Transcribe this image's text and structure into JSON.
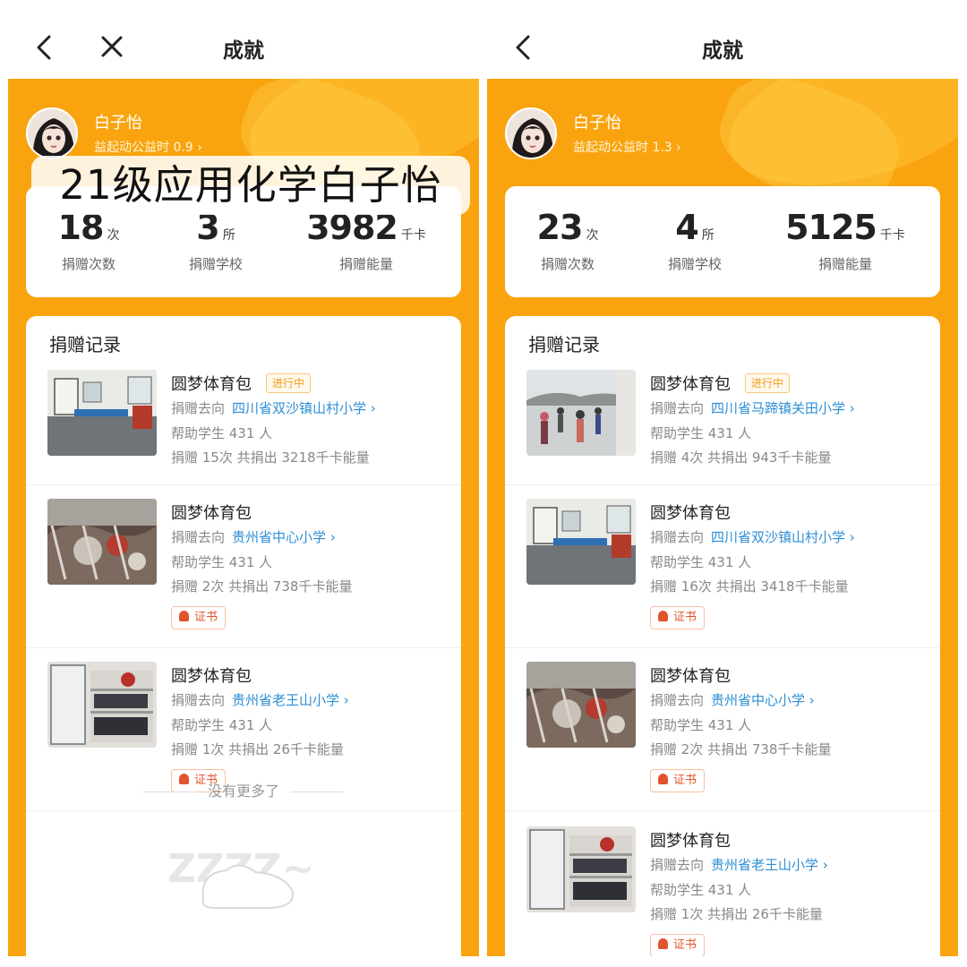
{
  "left": {
    "title": "成就",
    "user": {
      "name": "白子怡",
      "subtitle": "益起动公益时 0.9 ›"
    },
    "overlay": "21级应用化学白子怡",
    "stats": [
      {
        "value": "18",
        "unit": "次",
        "label": "捐赠次数"
      },
      {
        "value": "3",
        "unit": "所",
        "label": "捐赠学校"
      },
      {
        "value": "3982",
        "unit": "千卡",
        "label": "捐赠能量"
      }
    ],
    "records_title": "捐赠记录",
    "records": [
      {
        "name": "圆梦体育包",
        "tag": "进行中",
        "dest_label": "捐赠去向",
        "school": "四川省双沙镇山村小学 ›",
        "help": "帮助学生 431 人",
        "summary": "捐赠 15次 共捐出 3218千卡能量"
      },
      {
        "name": "圆梦体育包",
        "dest_label": "捐赠去向",
        "school": "贵州省中心小学 ›",
        "help": "帮助学生 431 人",
        "summary": "捐赠 2次 共捐出 738千卡能量",
        "cert": "证书"
      },
      {
        "name": "圆梦体育包",
        "dest_label": "捐赠去向",
        "school": "贵州省老王山小学 ›",
        "help": "帮助学生 431 人",
        "summary": "捐赠 1次 共捐出 26千卡能量",
        "cert": "证书"
      }
    ],
    "no_more": "没有更多了"
  },
  "right": {
    "title": "成就",
    "user": {
      "name": "白子怡",
      "subtitle": "益起动公益时 1.3 ›"
    },
    "stats": [
      {
        "value": "23",
        "unit": "次",
        "label": "捐赠次数"
      },
      {
        "value": "4",
        "unit": "所",
        "label": "捐赠学校"
      },
      {
        "value": "5125",
        "unit": "千卡",
        "label": "捐赠能量"
      }
    ],
    "records_title": "捐赠记录",
    "records": [
      {
        "name": "圆梦体育包",
        "tag": "进行中",
        "dest_label": "捐赠去向",
        "school": "四川省马蹄镇关田小学 ›",
        "help": "帮助学生 431 人",
        "summary": "捐赠 4次 共捐出 943千卡能量"
      },
      {
        "name": "圆梦体育包",
        "dest_label": "捐赠去向",
        "school": "四川省双沙镇山村小学 ›",
        "help": "帮助学生 431 人",
        "summary": "捐赠 16次 共捐出 3418千卡能量",
        "cert": "证书"
      },
      {
        "name": "圆梦体育包",
        "dest_label": "捐赠去向",
        "school": "贵州省中心小学 ›",
        "help": "帮助学生 431 人",
        "summary": "捐赠 2次 共捐出 738千卡能量",
        "cert": "证书"
      },
      {
        "name": "圆梦体育包",
        "dest_label": "捐赠去向",
        "school": "贵州省老王山小学 ›",
        "help": "帮助学生 431 人",
        "summary": "捐赠 1次 共捐出 26千卡能量",
        "cert": "证书"
      }
    ]
  },
  "colors": {
    "accent": "#f9a40f",
    "link": "#2d8fd5",
    "tag": "#f39c1a",
    "cert": "#e0552b"
  },
  "icons": {
    "back": "chevron-left-icon",
    "close": "close-icon",
    "cert": "ribbon-icon"
  }
}
